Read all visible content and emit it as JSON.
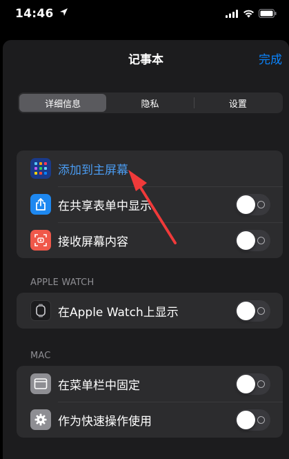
{
  "status_bar": {
    "time": "14:46"
  },
  "nav": {
    "title": "记事本",
    "done": "完成"
  },
  "tabs": [
    {
      "label": "详细信息",
      "active": true
    },
    {
      "label": "隐私",
      "active": false
    },
    {
      "label": "设置",
      "active": false
    }
  ],
  "group_main": [
    {
      "label": "添加到主屏幕",
      "icon": "home-screen-icon",
      "type": "link"
    },
    {
      "label": "在共享表单中显示",
      "icon": "share-icon",
      "type": "toggle",
      "value": false
    },
    {
      "label": "接收屏幕内容",
      "icon": "screen-capture-icon",
      "type": "toggle",
      "value": false
    }
  ],
  "section_watch": {
    "header": "APPLE WATCH",
    "rows": [
      {
        "label": "在Apple Watch上显示",
        "icon": "watch-icon",
        "type": "toggle",
        "value": false
      }
    ]
  },
  "section_mac": {
    "header": "MAC",
    "rows": [
      {
        "label": "在菜单栏中固定",
        "icon": "menu-bar-icon",
        "type": "toggle",
        "value": false
      },
      {
        "label": "作为快速操作使用",
        "icon": "gear-icon",
        "type": "toggle",
        "value": false
      }
    ]
  },
  "colors": {
    "accent": "#0a84ff",
    "link": "#4a9bf0",
    "annotation_arrow": "#f03a3a"
  }
}
